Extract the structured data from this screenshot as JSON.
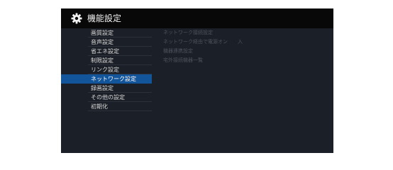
{
  "header": {
    "title": "機能設定",
    "icon": "gear-icon"
  },
  "menu": {
    "items": [
      {
        "label": "画質設定"
      },
      {
        "label": "音声設定"
      },
      {
        "label": "省エネ設定"
      },
      {
        "label": "制限設定"
      },
      {
        "label": "リンク設定"
      },
      {
        "label": "ネットワーク設定",
        "selected": true
      },
      {
        "label": "録画設定"
      },
      {
        "label": "その他の設定"
      },
      {
        "label": "初期化"
      }
    ]
  },
  "submenu": {
    "items": [
      {
        "label": "ネットワーク接続設定"
      },
      {
        "label": "ネットワーク経由で電源オン　　入"
      },
      {
        "label": "機器連携設定"
      },
      {
        "label": "宅外接続機器一覧"
      }
    ]
  },
  "colors": {
    "screen_bg": "#1b1f27",
    "title_bar_bg": "#080808",
    "selected_bg": "#12559a",
    "menu_text": "#d8d8d8",
    "submenu_text_dim": "#4c525c"
  }
}
